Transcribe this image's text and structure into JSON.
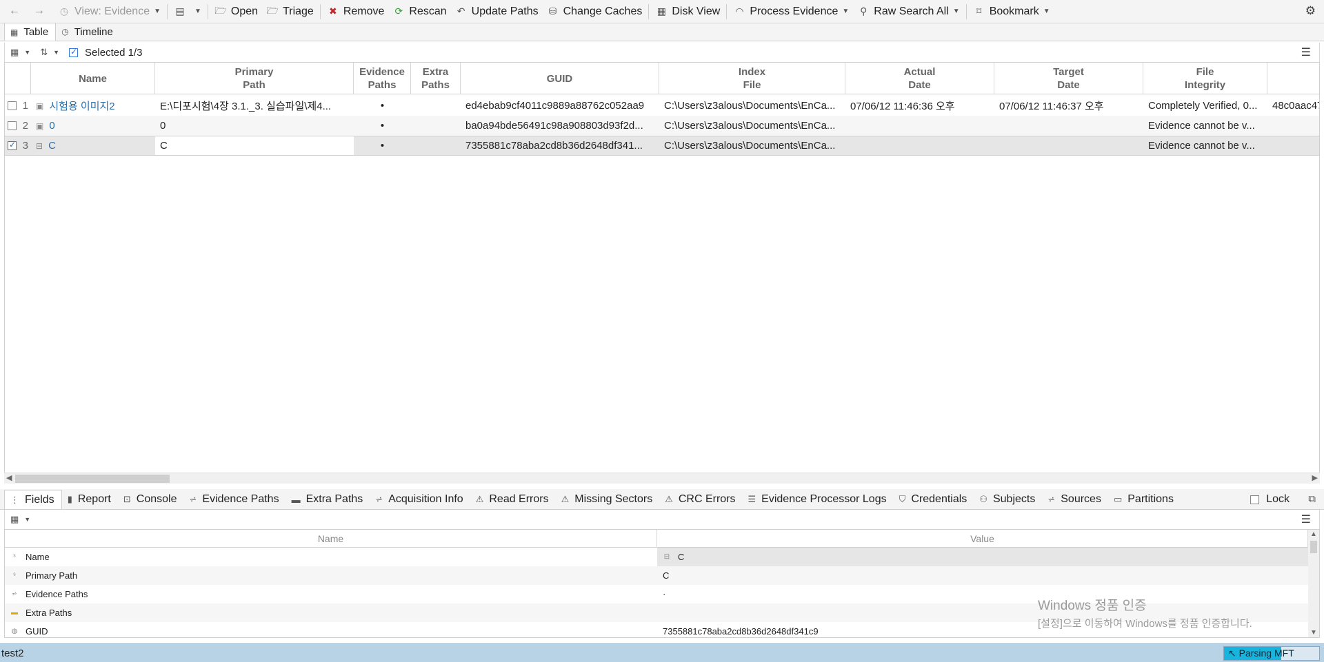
{
  "toolbar": {
    "view_label": "View: Evidence",
    "open": "Open",
    "triage": "Triage",
    "remove": "Remove",
    "rescan": "Rescan",
    "update_paths": "Update Paths",
    "change_caches": "Change Caches",
    "disk_view": "Disk View",
    "process_evidence": "Process Evidence",
    "raw_search_all": "Raw Search All",
    "bookmark": "Bookmark"
  },
  "view_tabs": {
    "table": "Table",
    "timeline": "Timeline"
  },
  "table_toolbar": {
    "selected": "Selected 1/3"
  },
  "columns": {
    "name": "Name",
    "primary_path": "Primary\nPath",
    "evidence_paths": "Evidence\nPaths",
    "extra_paths": "Extra\nPaths",
    "guid": "GUID",
    "index_file": "Index\nFile",
    "actual_date": "Actual\nDate",
    "target_date": "Target\nDate",
    "file_integrity": "File\nIntegrity"
  },
  "rows": [
    {
      "index": "1",
      "name": "시험용 이미지2",
      "primary_path": "E:\\디포시험\\4장 3.1._3. 실습파일\\제4...",
      "evidence_paths": "•",
      "extra_paths": "",
      "guid": "ed4ebab9cf4011c9889a88762c052aa9",
      "index_file": "C:\\Users\\z3alous\\Documents\\EnCa...",
      "actual_date": "07/06/12 11:46:36 오후",
      "target_date": "07/06/12 11:46:37 오후",
      "file_integrity": "Completely Verified, 0...",
      "extra": "48c0aac47"
    },
    {
      "index": "2",
      "name": "0",
      "primary_path": "0",
      "evidence_paths": "•",
      "extra_paths": "",
      "guid": "ba0a94bde56491c98a908803d93f2d...",
      "index_file": "C:\\Users\\z3alous\\Documents\\EnCa...",
      "actual_date": "",
      "target_date": "",
      "file_integrity": "Evidence cannot be v...",
      "extra": ""
    },
    {
      "index": "3",
      "name": "C",
      "primary_path": "C",
      "evidence_paths": "•",
      "extra_paths": "",
      "guid": "7355881c78aba2cd8b36d2648df341...",
      "index_file": "C:\\Users\\z3alous\\Documents\\EnCa...",
      "actual_date": "",
      "target_date": "",
      "file_integrity": "Evidence cannot be v...",
      "extra": ""
    }
  ],
  "bottom_tabs": {
    "fields": "Fields",
    "report": "Report",
    "console": "Console",
    "evidence_paths": "Evidence Paths",
    "extra_paths": "Extra Paths",
    "acquisition_info": "Acquisition Info",
    "read_errors": "Read Errors",
    "missing_sectors": "Missing Sectors",
    "crc_errors": "CRC Errors",
    "evidence_processor_logs": "Evidence Processor Logs",
    "credentials": "Credentials",
    "subjects": "Subjects",
    "sources": "Sources",
    "partitions": "Partitions",
    "lock": "Lock"
  },
  "fields_table": {
    "name_header": "Name",
    "value_header": "Value",
    "rows": [
      {
        "name": "Name",
        "value": "C"
      },
      {
        "name": "Primary Path",
        "value": "C"
      },
      {
        "name": "Evidence Paths",
        "value": "·"
      },
      {
        "name": "Extra Paths",
        "value": ""
      },
      {
        "name": "GUID",
        "value": "7355881c78aba2cd8b36d2648df341c9"
      }
    ]
  },
  "watermark": {
    "line1": "Windows 정품 인증",
    "line2": "[설정]으로 이동하여 Windows를 정품 인증합니다."
  },
  "status": {
    "case_name": "test2",
    "progress_label": "Parsing MFT",
    "progress_fraction": 0.6
  }
}
